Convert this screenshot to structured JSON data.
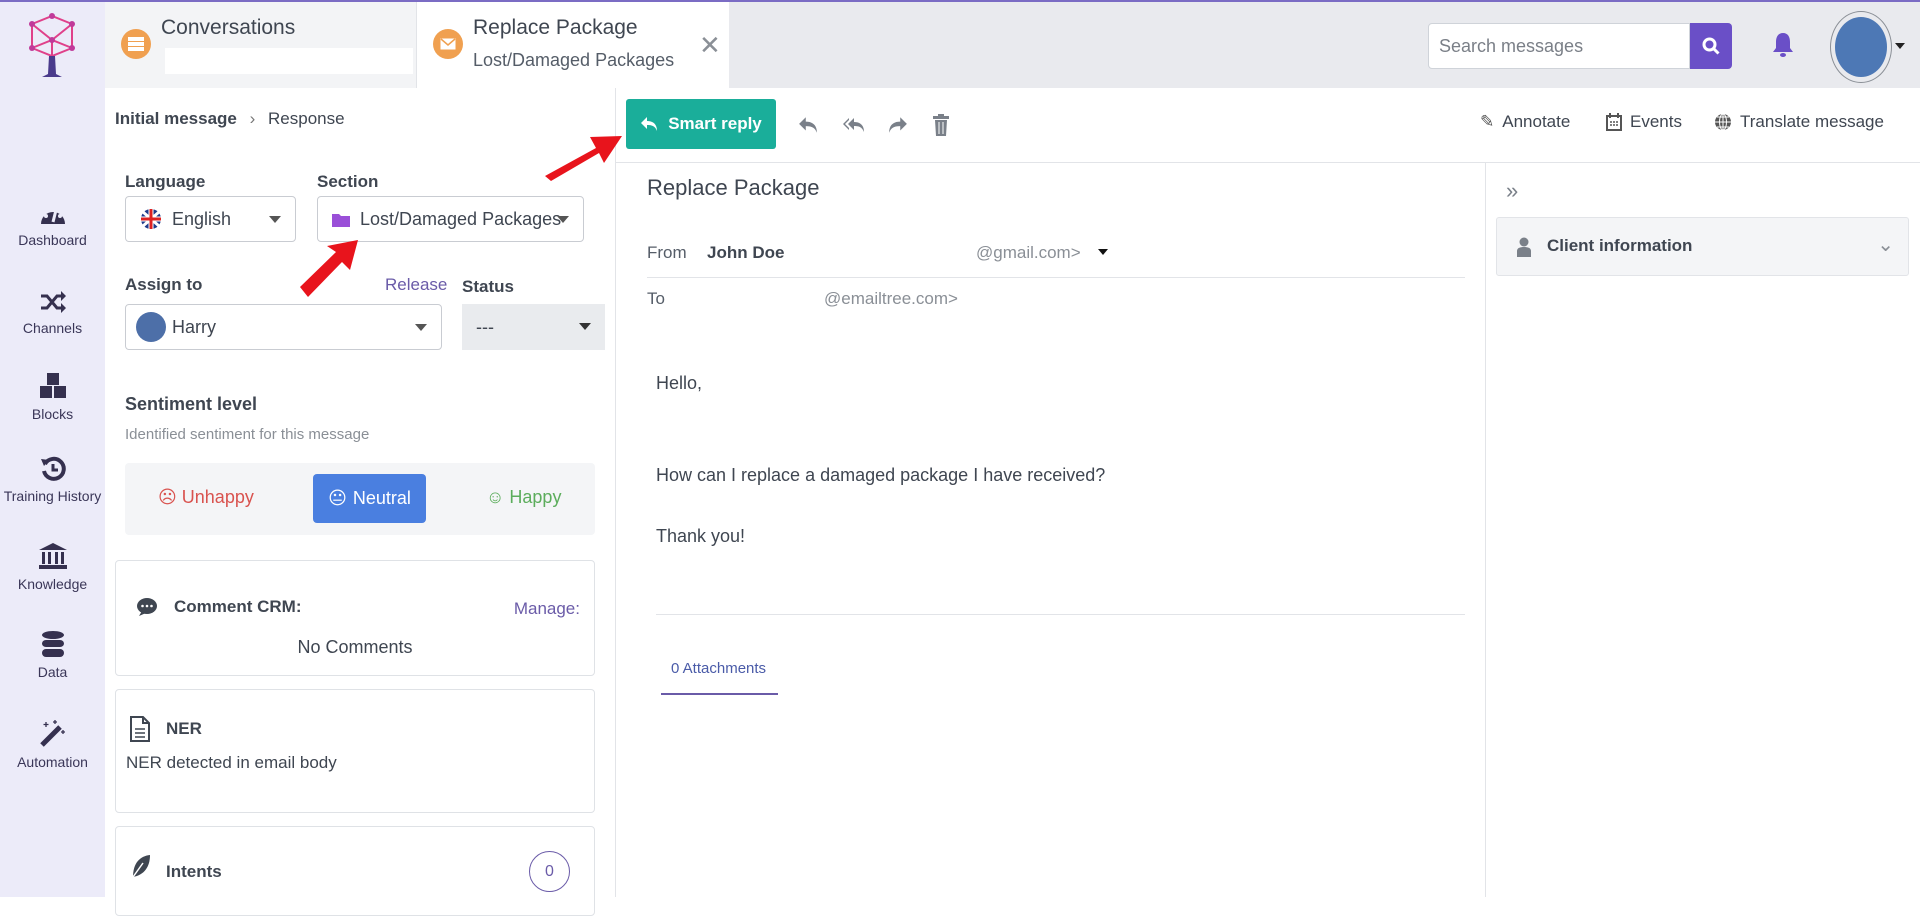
{
  "nav": {
    "items": [
      {
        "label": "Dashboard",
        "icon": "dashboard-gauge-icon"
      },
      {
        "label": "Channels",
        "icon": "shuffle-icon"
      },
      {
        "label": "Blocks",
        "icon": "cubes-icon"
      },
      {
        "label": "Training History",
        "icon": "history-icon"
      },
      {
        "label": "Knowledge",
        "icon": "bank-icon"
      },
      {
        "label": "Data",
        "icon": "database-icon"
      },
      {
        "label": "Automation",
        "icon": "magic-wand-icon"
      }
    ]
  },
  "tabs": [
    {
      "title": "Conversations",
      "subtitle": "",
      "icon": "list-icon"
    },
    {
      "title": "Replace Package",
      "subtitle": "Lost/Damaged Packages",
      "icon": "envelope-icon"
    }
  ],
  "header": {
    "search_placeholder": "Search messages"
  },
  "left": {
    "breadcrumb": [
      "Initial message",
      "Response"
    ],
    "language_label": "Language",
    "language_value": "English",
    "section_label": "Section",
    "section_value": "Lost/Damaged Packages",
    "assign_label": "Assign to",
    "release": "Release",
    "assignee": "Harry",
    "status_label": "Status",
    "status_value": "---",
    "sentiment_title": "Sentiment level",
    "sentiment_sub": "Identified sentiment for this message",
    "sentiments": [
      {
        "label": "Unhappy",
        "color": "#d9534f"
      },
      {
        "label": "Neutral",
        "color": "#4a7fe0",
        "selected": true
      },
      {
        "label": "Happy",
        "color": "#5cad5c"
      }
    ],
    "comment_title": "Comment CRM:",
    "comment_manage": "Manage:",
    "comment_empty": "No Comments",
    "ner_title": "NER",
    "ner_text": "NER detected in email body",
    "intents_title": "Intents",
    "intents_count": "0"
  },
  "toolbar": {
    "smart_reply": "Smart reply",
    "annotate": "Annotate",
    "events": "Events",
    "translate": "Translate message"
  },
  "email": {
    "subject": "Replace Package",
    "from_label": "From",
    "from_name": "John Doe",
    "from_email": "@gmail.com>",
    "to_label": "To",
    "to_email": "@emailtree.com>",
    "body": [
      "Hello,",
      "How can I replace a damaged package I have received?",
      "Thank you!"
    ],
    "attachments": "0 Attachments"
  },
  "right": {
    "client_info": "Client information"
  },
  "colors": {
    "accent": "#6a4fc7",
    "smart_reply": "#1aae9a",
    "annotation": "#e8141c"
  }
}
